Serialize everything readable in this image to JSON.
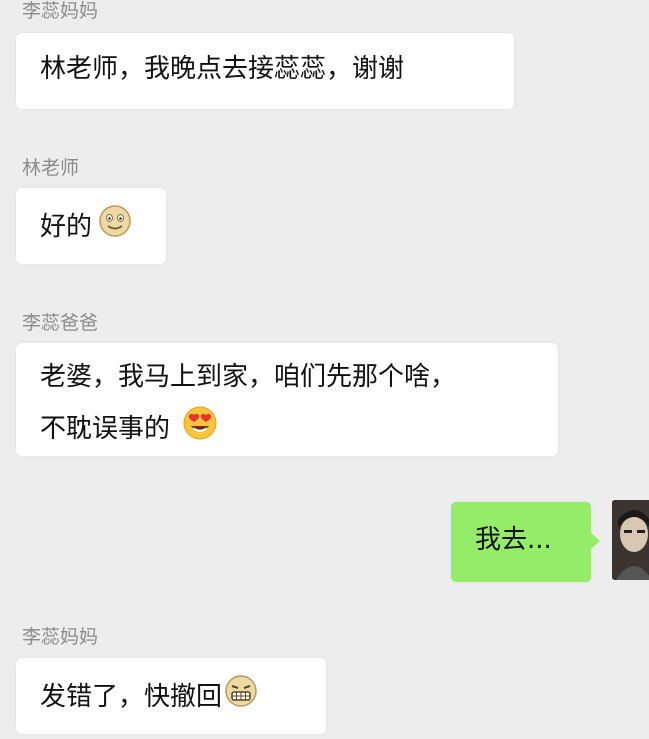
{
  "messages": [
    {
      "sender": "李蕊妈妈",
      "lines": [
        "林老师，我晚点去接蕊蕊，谢谢"
      ],
      "emoji": ""
    },
    {
      "sender": "林老师",
      "lines": [
        "好的"
      ],
      "emoji": "smile-face-icon"
    },
    {
      "sender": "李蕊爸爸",
      "lines": [
        "老婆，我马上到家，咱们先那个啥，",
        "不耽误事的"
      ],
      "emoji": "heart-eyes-face-icon"
    },
    {
      "sender": "",
      "lines": [
        "我去..."
      ],
      "emoji": ""
    },
    {
      "sender": "李蕊妈妈",
      "lines": [
        "发错了，快撤回"
      ],
      "emoji": "grimace-face-icon"
    }
  ],
  "colors": {
    "background": "#ededed",
    "received_bubble": "#ffffff",
    "sent_bubble": "#95ec69",
    "sender_name": "#8c8c8c"
  }
}
